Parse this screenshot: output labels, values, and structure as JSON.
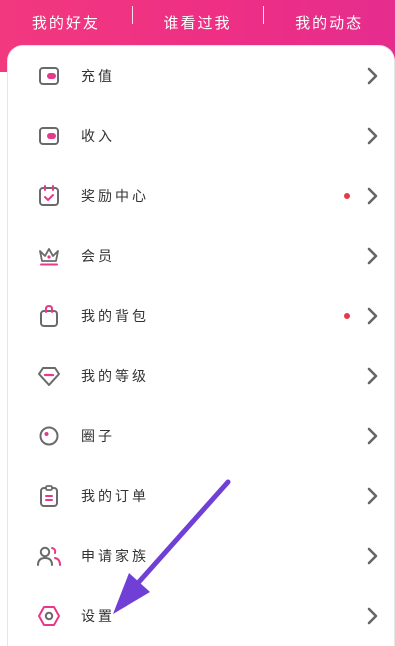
{
  "tabs": [
    "我的好友",
    "谁看过我",
    "我的动态"
  ],
  "menu": [
    {
      "label": "充值",
      "icon": "wallet-icon",
      "dot": false
    },
    {
      "label": "收入",
      "icon": "income-wallet-icon",
      "dot": false
    },
    {
      "label": "奖励中心",
      "icon": "calendar-check-icon",
      "dot": true
    },
    {
      "label": "会员",
      "icon": "crown-icon",
      "dot": false
    },
    {
      "label": "我的背包",
      "icon": "bag-icon",
      "dot": true
    },
    {
      "label": "我的等级",
      "icon": "diamond-icon",
      "dot": false
    },
    {
      "label": "圈子",
      "icon": "circle-icon",
      "dot": false
    },
    {
      "label": "我的订单",
      "icon": "clipboard-icon",
      "dot": false
    },
    {
      "label": "申请家族",
      "icon": "users-icon",
      "dot": false
    },
    {
      "label": "设置",
      "icon": "settings-icon",
      "dot": false
    }
  ],
  "colors": {
    "accent": "#e8388a",
    "header_gradient_start": "#f2387f",
    "header_gradient_end": "#e52d8e",
    "badge": "#e6394a",
    "arrow": "#6f3fd6"
  }
}
